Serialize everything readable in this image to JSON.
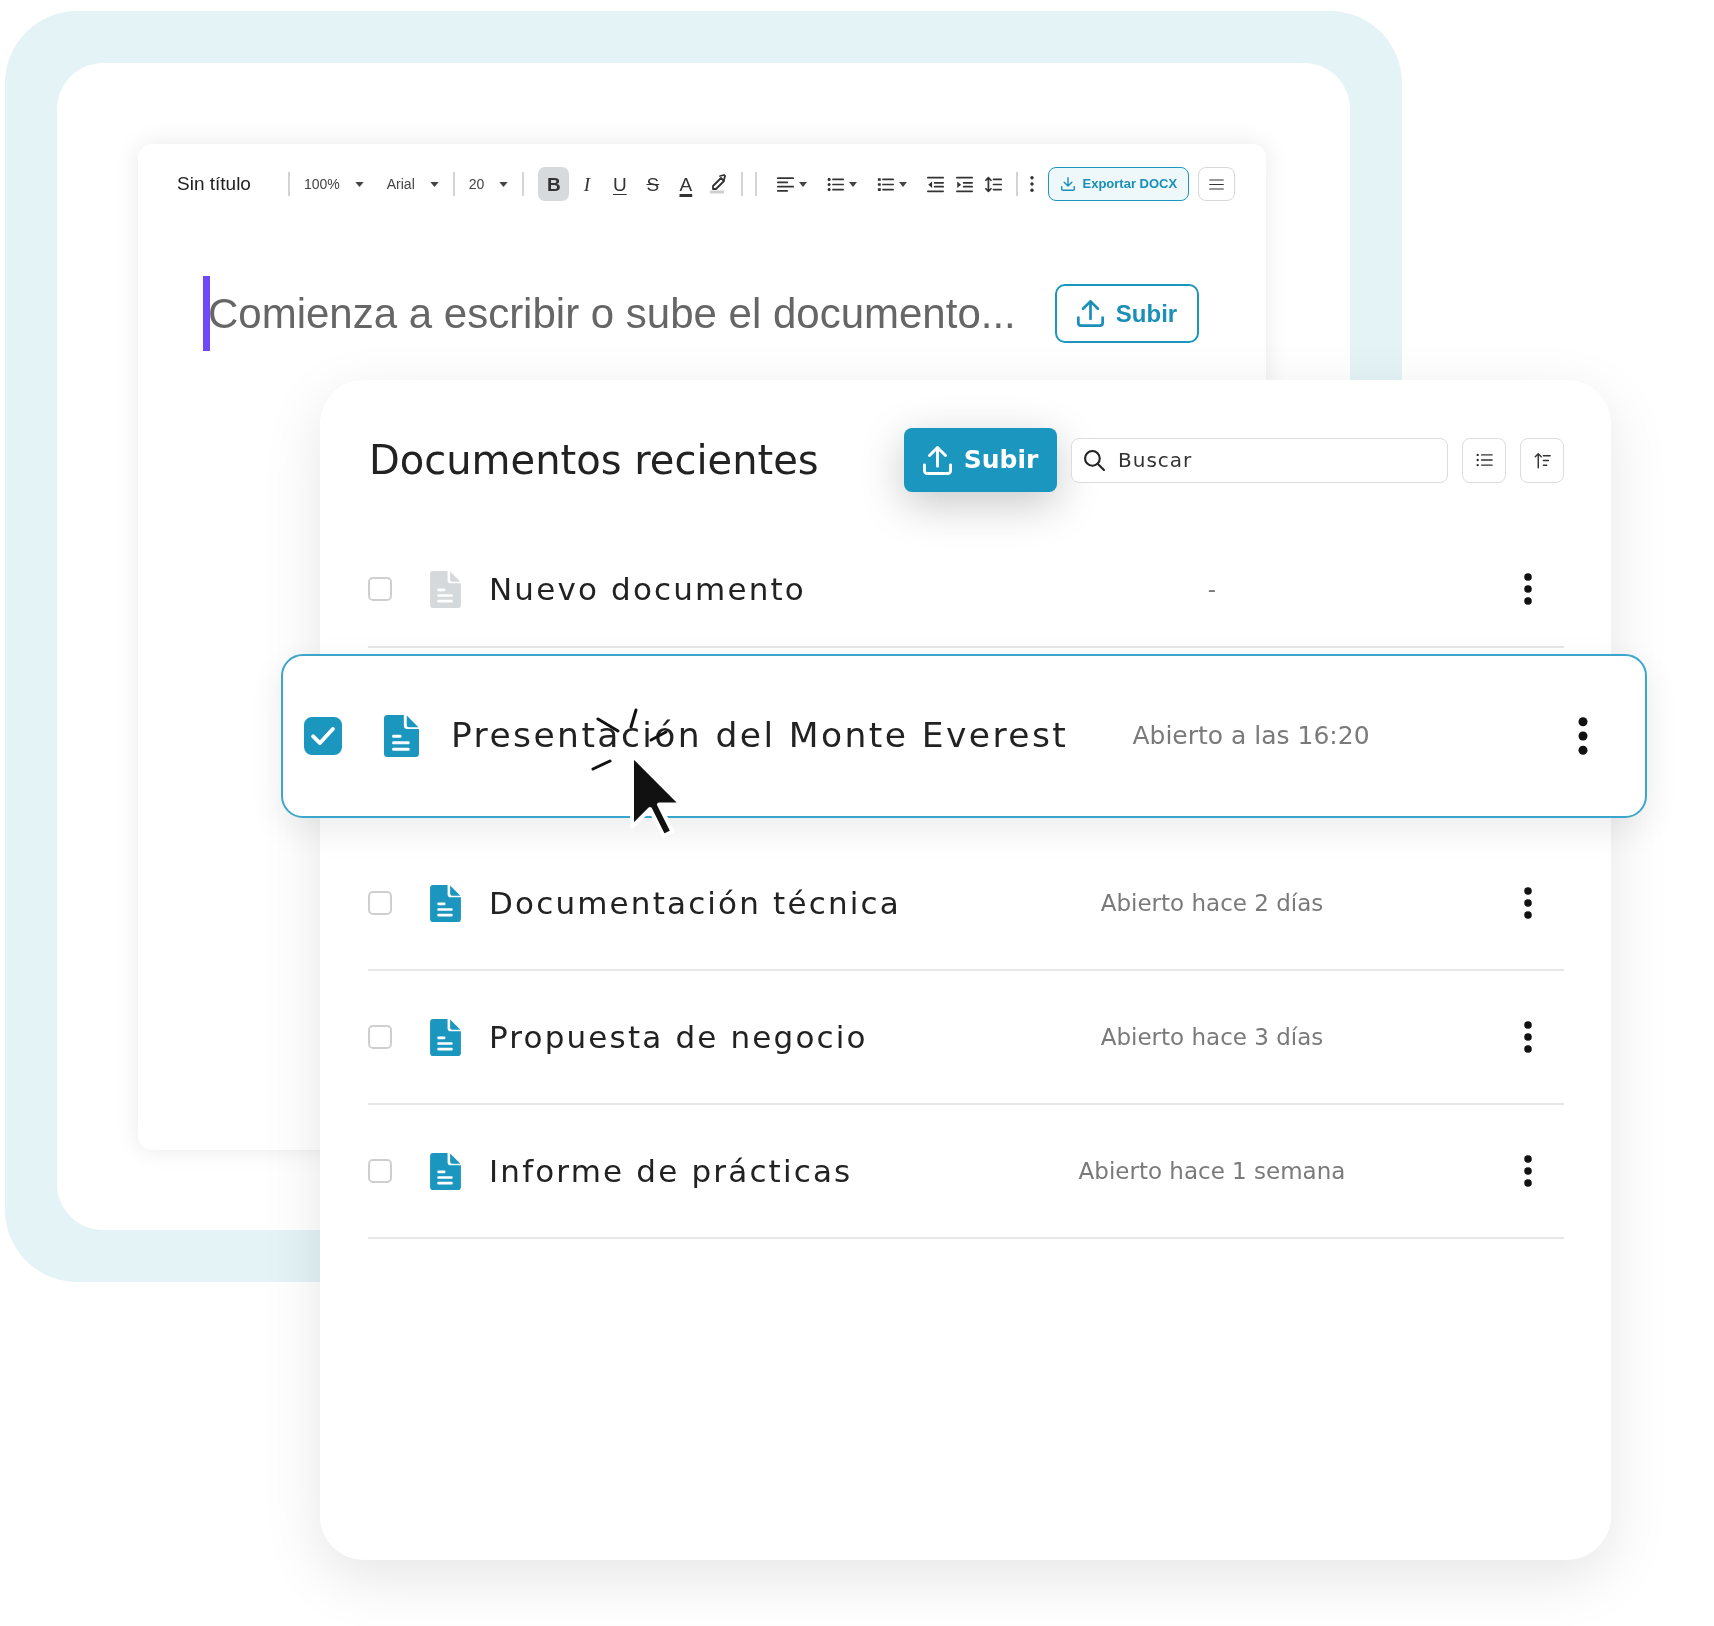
{
  "editor": {
    "toolbar": {
      "title": "Sin título",
      "zoom": "100%",
      "font": "Arial",
      "font_size": "20",
      "format_buttons": [
        {
          "kind": "bold",
          "glyph": "B",
          "active": true
        },
        {
          "kind": "italic",
          "glyph": "I",
          "active": false
        },
        {
          "kind": "underline",
          "glyph": "U",
          "active": false
        },
        {
          "kind": "strikethrough",
          "glyph": "S",
          "active": false
        },
        {
          "kind": "text_color",
          "glyph": "A",
          "active": false
        }
      ],
      "export_label": "Exportar DOCX"
    },
    "placeholder": "Comienza a escribir o sube el documento...",
    "upload_label": "Subir"
  },
  "documents": {
    "title": "Documentos recientes",
    "upload_label": "Subir",
    "search": {
      "placeholder": "Buscar"
    },
    "rows": [
      {
        "kind": "new",
        "name": "Nuevo documento",
        "opened": "-",
        "checked": false,
        "selected": false
      },
      {
        "kind": "document",
        "name": "Presentación del Monte Everest",
        "opened": "Abierto a las 16:20",
        "checked": true,
        "selected": true
      },
      {
        "kind": "document",
        "name": "Documentación técnica",
        "opened": "Abierto hace 2 días",
        "checked": false,
        "selected": false
      },
      {
        "kind": "document",
        "name": "Propuesta de negocio",
        "opened": "Abierto hace 3 días",
        "checked": false,
        "selected": false
      },
      {
        "kind": "document",
        "name": "Informe de prácticas",
        "opened": "Abierto hace 1 semana",
        "checked": false,
        "selected": false
      }
    ]
  }
}
